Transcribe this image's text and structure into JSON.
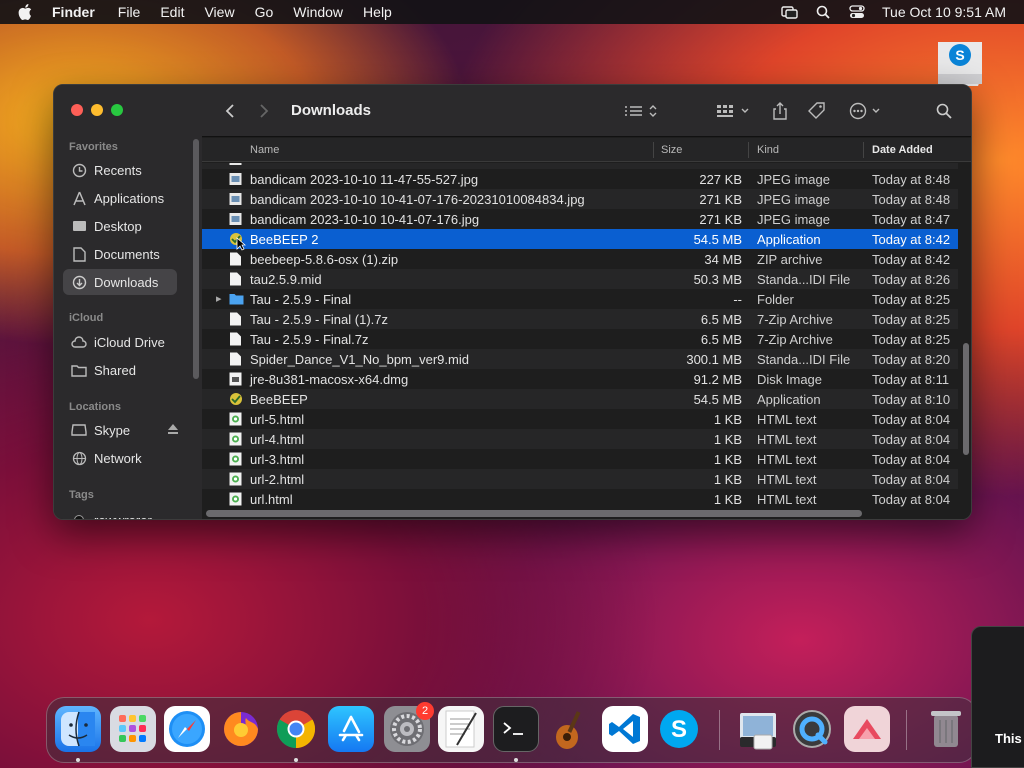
{
  "menubar": {
    "app": "Finder",
    "items": [
      "File",
      "Edit",
      "View",
      "Go",
      "Window",
      "Help"
    ],
    "clock": "Tue Oct 10  9:51 AM"
  },
  "window": {
    "title": "Downloads",
    "sidebar": {
      "favorites_label": "Favorites",
      "favorites": [
        "Recents",
        "Applications",
        "Desktop",
        "Documents",
        "Downloads"
      ],
      "icloud_label": "iCloud",
      "icloud": [
        "iCloud Drive",
        "Shared"
      ],
      "locations_label": "Locations",
      "locations": [
        "Skype",
        "Network"
      ],
      "tags_label": "Tags",
      "tags": [
        "rewwrerer"
      ]
    },
    "columns": {
      "name": "Name",
      "size": "Size",
      "kind": "Kind",
      "date": "Date Added"
    },
    "files": [
      {
        "name": "bandicam 2023-10-10 11-47-55-527.jpg",
        "size": "227 KB",
        "kind": "JPEG image",
        "date": "Today at 8:48"
      },
      {
        "name": "bandicam 2023-10-10 10-41-07-176-20231010084834.jpg",
        "size": "271 KB",
        "kind": "JPEG image",
        "date": "Today at 8:48"
      },
      {
        "name": "bandicam 2023-10-10 10-41-07-176.jpg",
        "size": "271 KB",
        "kind": "JPEG image",
        "date": "Today at 8:47"
      },
      {
        "name": "BeeBEEP 2",
        "size": "54.5 MB",
        "kind": "Application",
        "date": "Today at 8:42"
      },
      {
        "name": "beebeep-5.8.6-osx (1).zip",
        "size": "34 MB",
        "kind": "ZIP archive",
        "date": "Today at 8:42"
      },
      {
        "name": "tau2.5.9.mid",
        "size": "50.3 MB",
        "kind": "Standa...IDI File",
        "date": "Today at 8:26"
      },
      {
        "name": "Tau - 2.5.9 - Final",
        "size": "--",
        "kind": "Folder",
        "date": "Today at 8:25"
      },
      {
        "name": "Tau - 2.5.9 - Final (1).7z",
        "size": "6.5 MB",
        "kind": "7-Zip Archive",
        "date": "Today at 8:25"
      },
      {
        "name": "Tau - 2.5.9 - Final.7z",
        "size": "6.5 MB",
        "kind": "7-Zip Archive",
        "date": "Today at 8:25"
      },
      {
        "name": "Spider_Dance_V1_No_bpm_ver9.mid",
        "size": "300.1 MB",
        "kind": "Standa...IDI File",
        "date": "Today at 8:20"
      },
      {
        "name": "jre-8u381-macosx-x64.dmg",
        "size": "91.2 MB",
        "kind": "Disk Image",
        "date": "Today at 8:11"
      },
      {
        "name": "BeeBEEP",
        "size": "54.5 MB",
        "kind": "Application",
        "date": "Today at 8:10"
      },
      {
        "name": "url-5.html",
        "size": "1 KB",
        "kind": "HTML text",
        "date": "Today at 8:04"
      },
      {
        "name": "url-4.html",
        "size": "1 KB",
        "kind": "HTML text",
        "date": "Today at 8:04"
      },
      {
        "name": "url-3.html",
        "size": "1 KB",
        "kind": "HTML text",
        "date": "Today at 8:04"
      },
      {
        "name": "url-2.html",
        "size": "1 KB",
        "kind": "HTML text",
        "date": "Today at 8:04"
      },
      {
        "name": "url.html",
        "size": "1 KB",
        "kind": "HTML text",
        "date": "Today at 8:04"
      }
    ],
    "selected_index": 3
  },
  "dock": {
    "settings_badge": "2"
  },
  "notification_text": "This"
}
